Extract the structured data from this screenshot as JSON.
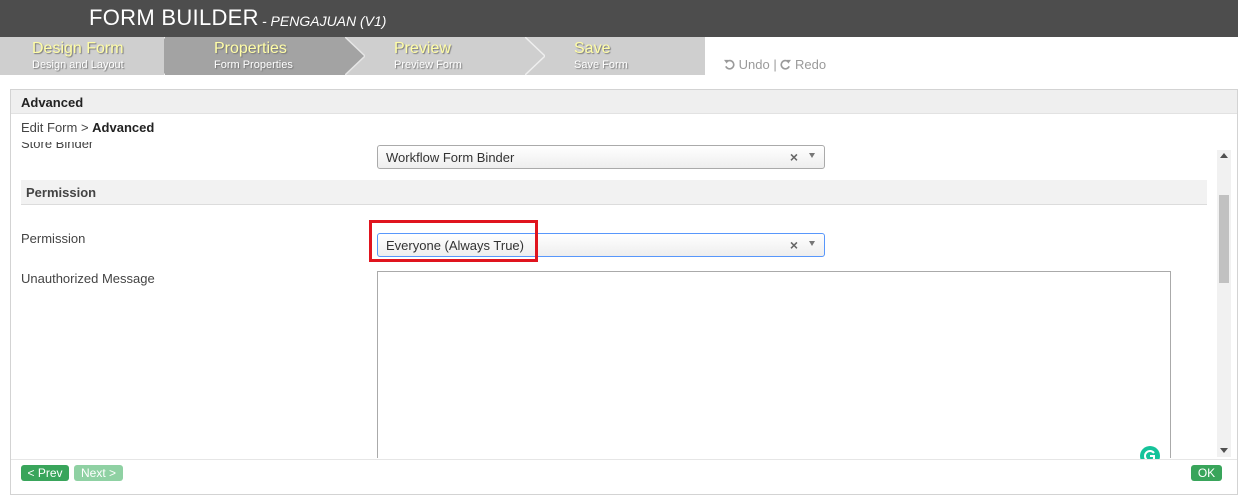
{
  "header": {
    "title": "FORM BUILDER",
    "subtitle": "- PENGAJUAN (V1)"
  },
  "steps": [
    {
      "label": "Design Form",
      "sub": "Design and Layout"
    },
    {
      "label": "Properties",
      "sub": "Form Properties"
    },
    {
      "label": "Preview",
      "sub": "Preview Form"
    },
    {
      "label": "Save",
      "sub": "Save Form"
    }
  ],
  "toolbar": {
    "undo_label": "Undo",
    "separator": "|",
    "redo_label": "Redo"
  },
  "panel": {
    "title": "Advanced",
    "breadcrumb_root": "Edit Form >",
    "breadcrumb_current": "Advanced"
  },
  "form": {
    "store_binder_label": "Store Binder",
    "store_binder_value": "Workflow Form Binder",
    "section_title": "Permission",
    "permission_label": "Permission",
    "permission_value": "Everyone (Always True)",
    "unauthorized_label": "Unauthorized Message",
    "unauthorized_value": "",
    "clear_glyph": "×"
  },
  "footer": {
    "prev_label": "< Prev",
    "next_label": "Next >",
    "ok_label": "OK"
  },
  "colors": {
    "titlebar": "#4d4d4d",
    "step_label": "#fffda7",
    "highlight": "#e0141e",
    "button_green": "#39a55b",
    "grammarly": "#15c39a"
  },
  "icons": {
    "undo": "undo-icon",
    "redo": "redo-icon",
    "grammarly": "grammarly-icon"
  }
}
